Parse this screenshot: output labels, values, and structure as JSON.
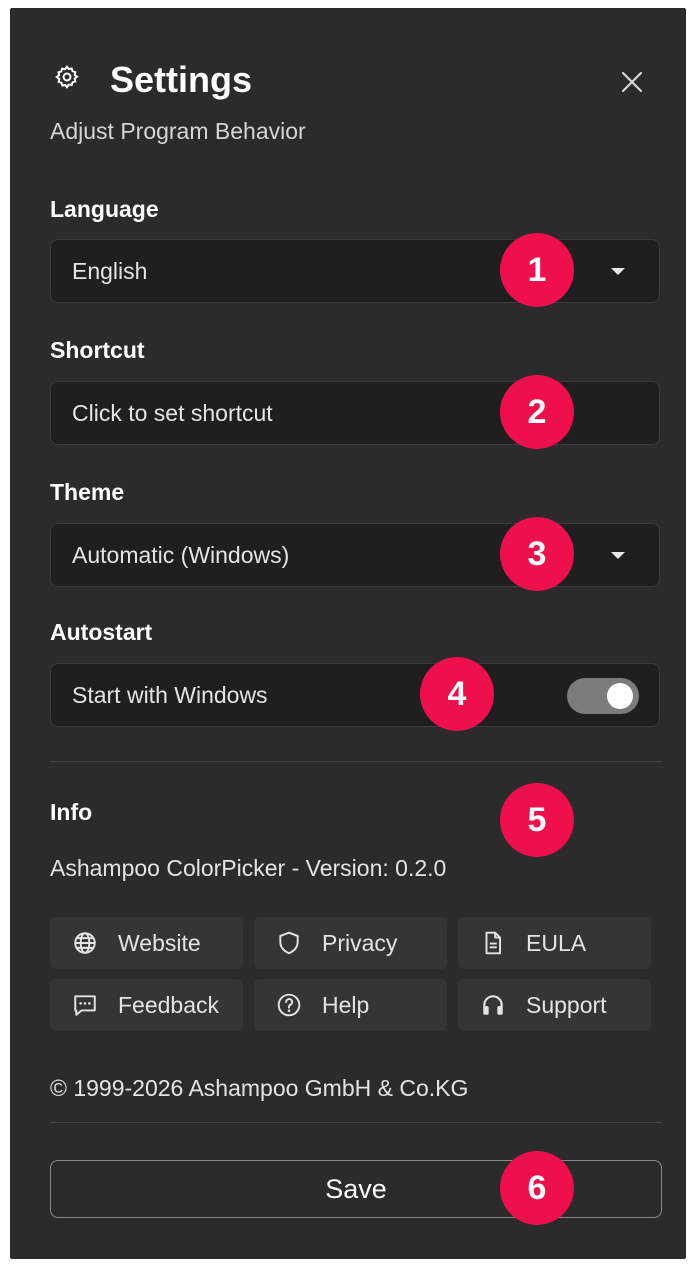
{
  "header": {
    "title": "Settings",
    "subtitle": "Adjust Program Behavior",
    "gear_icon": "gear-icon",
    "close_icon": "close-icon"
  },
  "language": {
    "label": "Language",
    "value": "English"
  },
  "shortcut": {
    "label": "Shortcut",
    "placeholder": "Click to set shortcut"
  },
  "theme": {
    "label": "Theme",
    "value": "Automatic (Windows)"
  },
  "autostart": {
    "label": "Autostart",
    "toggle_label": "Start with Windows",
    "enabled": true
  },
  "info": {
    "label": "Info",
    "version_text": "Ashampoo ColorPicker - Version: 0.2.0",
    "links": [
      {
        "label": "Website",
        "icon": "globe-icon"
      },
      {
        "label": "Privacy",
        "icon": "shield-icon"
      },
      {
        "label": "EULA",
        "icon": "document-icon"
      },
      {
        "label": "Feedback",
        "icon": "chat-icon"
      },
      {
        "label": "Help",
        "icon": "help-icon"
      },
      {
        "label": "Support",
        "icon": "headset-icon"
      }
    ],
    "copyright": "© 1999-2026 Ashampoo GmbH & Co.KG"
  },
  "save_label": "Save",
  "badges": [
    "1",
    "2",
    "3",
    "4",
    "5",
    "6"
  ],
  "colors": {
    "panel_bg": "#2b2b2b",
    "field_bg": "#1f1f1f",
    "badge": "#ee0f4c",
    "text": "#e8e8e8"
  }
}
